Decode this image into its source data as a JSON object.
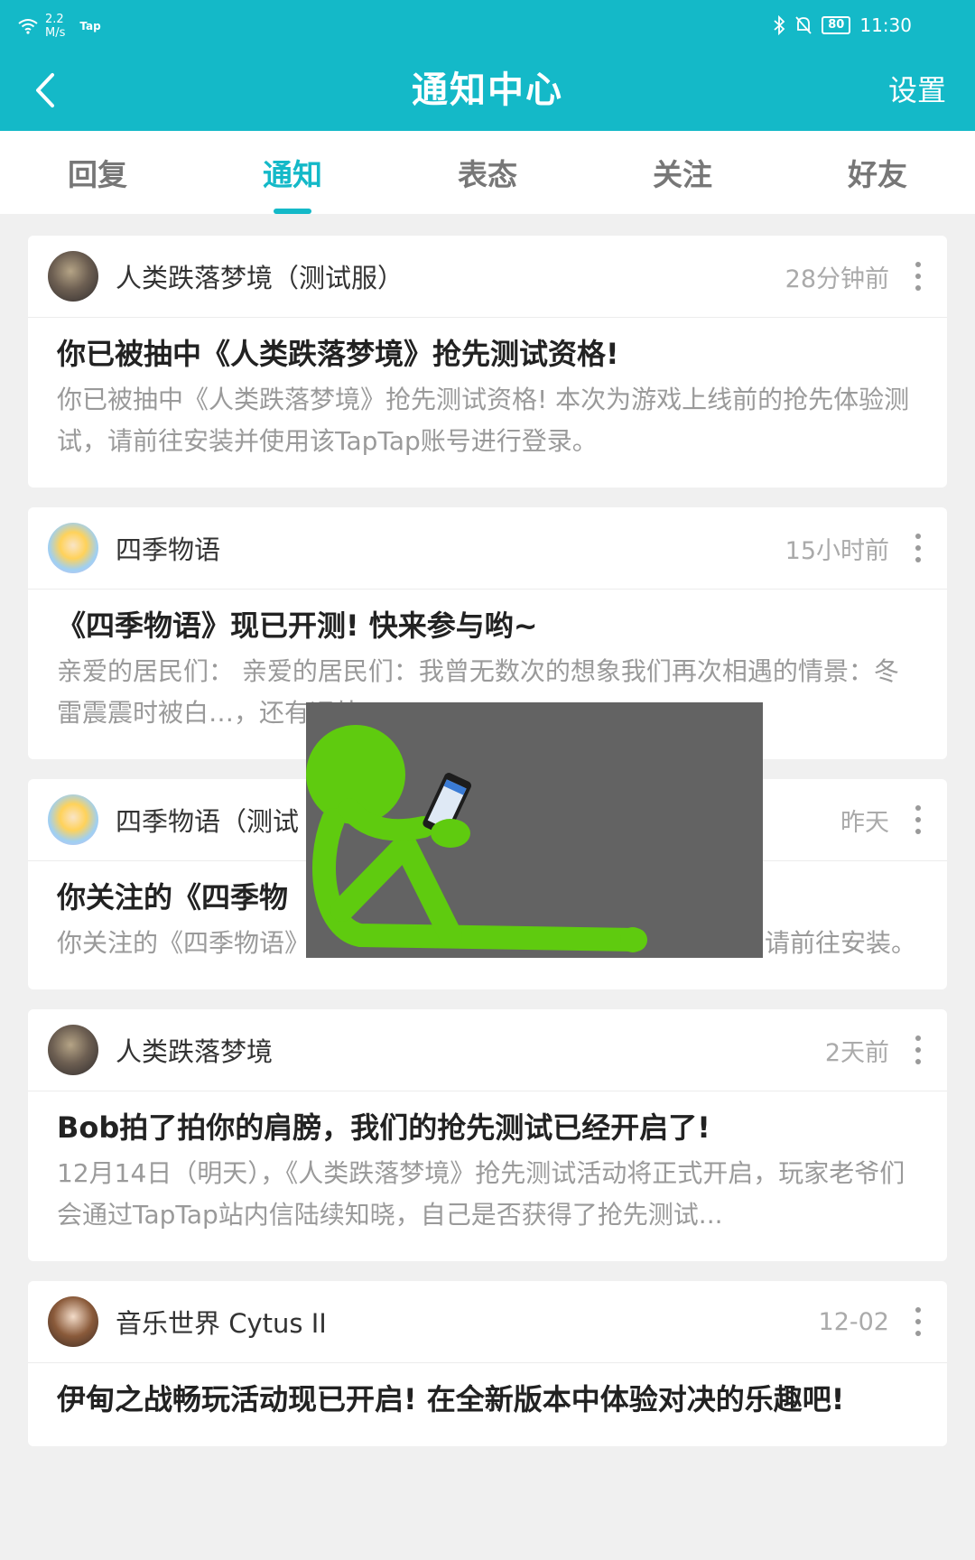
{
  "status_bar": {
    "speed_value": "2.2",
    "speed_unit": "M/s",
    "app_label": "Tap",
    "battery": "80",
    "time": "11:30"
  },
  "header": {
    "title": "通知中心",
    "settings_label": "设置"
  },
  "tabs": [
    {
      "label": "回复",
      "active": false
    },
    {
      "label": "通知",
      "active": true
    },
    {
      "label": "表态",
      "active": false
    },
    {
      "label": "关注",
      "active": false
    },
    {
      "label": "好友",
      "active": false
    }
  ],
  "notifications": [
    {
      "source": "人类跌落梦境（测试服）",
      "time": "28分钟前",
      "title": "你已被抽中《人类跌落梦境》抢先测试资格!",
      "text": "你已被抽中《人类跌落梦境》抢先测试资格! 本次为游戏上线前的抢先体验测试，请前往安装并使用该TapTap账号进行登录。"
    },
    {
      "source": "四季物语",
      "time": "15小时前",
      "title": "《四季物语》现已开测! 快来参与哟~",
      "text": "亲爱的居民们： 亲爱的居民们：我曾无数次的想象我们再次相遇的情景：冬雷震震时被白…，还有远处..."
    },
    {
      "source": "四季物语（测试",
      "time": "昨天",
      "title": "你关注的《四季物",
      "text": "你关注的《四季物语》安卓版已经开放测试，本次为删档测试，请前往安装。"
    },
    {
      "source": "人类跌落梦境",
      "time": "2天前",
      "title": "Bob拍了拍你的肩膀，我们的抢先测试已经开启了!",
      "text": "12月14日（明天），《人类跌落梦境》抢先测试活动将正式开启，玩家老爷们会通过TapTap站内信陆续知晓，自己是否获得了抢先测试..."
    },
    {
      "source": "音乐世界 Cytus II",
      "time": "12-02",
      "title": "伊甸之战畅玩活动现已开启! 在全新版本中体验对决的乐趣吧!",
      "text": ""
    }
  ],
  "colors": {
    "brand": "#14b9c8",
    "overlay_figure": "#5fcb0f"
  }
}
